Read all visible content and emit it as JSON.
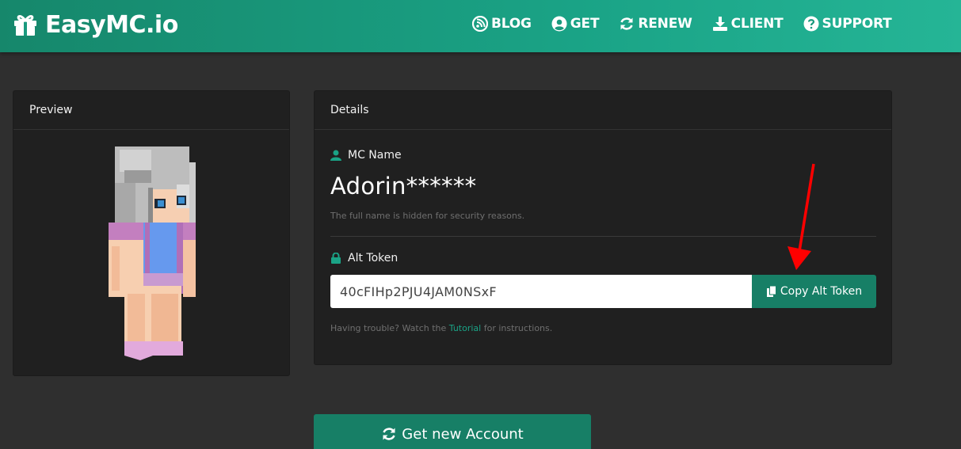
{
  "brand": {
    "name": "EasyMC.io",
    "icon": "gift-icon"
  },
  "nav": [
    {
      "label": "BLOG",
      "icon": "blog-feed-icon"
    },
    {
      "label": "GET",
      "icon": "user-circle-icon"
    },
    {
      "label": "RENEW",
      "icon": "refresh-icon"
    },
    {
      "label": "CLIENT",
      "icon": "download-icon"
    },
    {
      "label": "SUPPORT",
      "icon": "question-circle-icon"
    }
  ],
  "preview": {
    "title": "Preview"
  },
  "details": {
    "title": "Details",
    "mc_name_label": "MC Name",
    "mc_name_value": "Adorin******",
    "security_hint": "The full name is hidden for security reasons.",
    "alt_token_label": "Alt Token",
    "alt_token_value": "40cFIHp2PJU4JAM0NSxF",
    "copy_button": "Copy Alt Token",
    "trouble_prefix": "Having trouble? Watch the ",
    "tutorial_link": "Tutorial",
    "trouble_suffix": " for instructions."
  },
  "get_new_button": "Get new Account",
  "colors": {
    "header_start": "#16876b",
    "header_end": "#25b596",
    "accent": "#177f66",
    "background": "#2f2f2f",
    "panel": "#202020",
    "annotation_arrow": "#ff0000"
  }
}
